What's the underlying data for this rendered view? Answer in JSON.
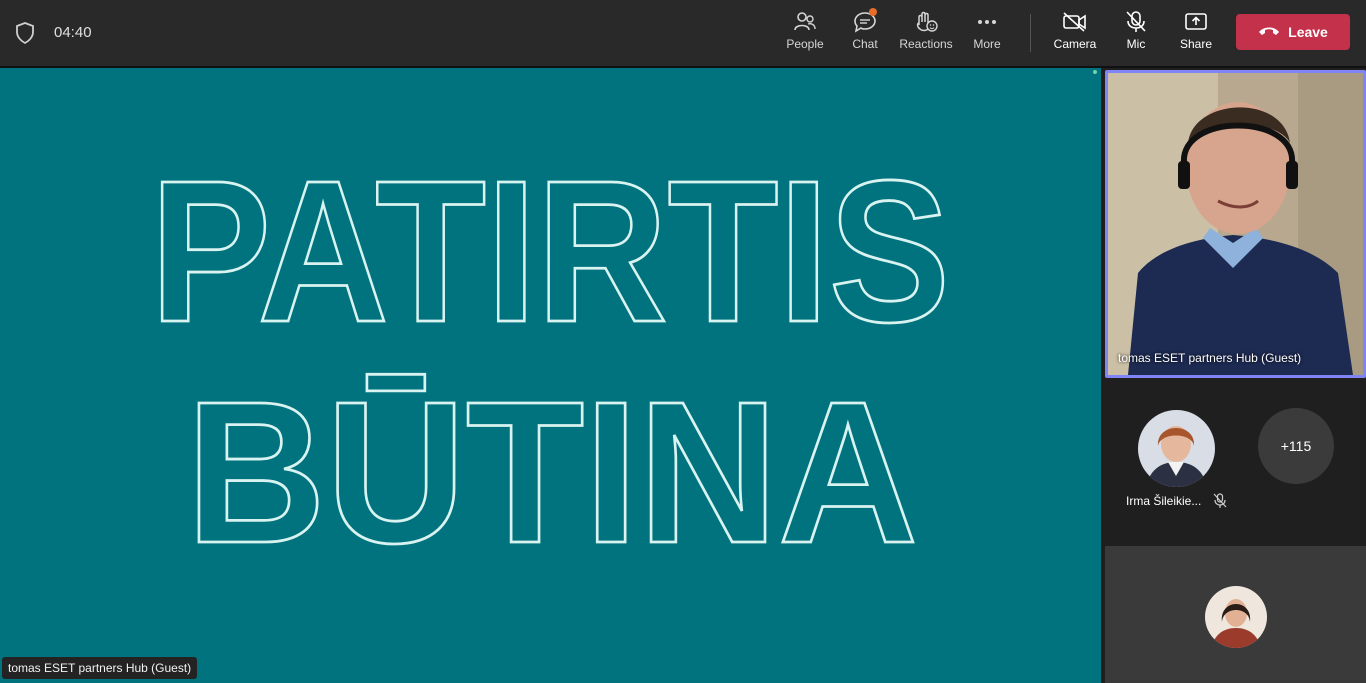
{
  "topbar": {
    "timer": "04:40",
    "people_label": "People",
    "chat_label": "Chat",
    "reactions_label": "Reactions",
    "more_label": "More",
    "camera_label": "Camera",
    "mic_label": "Mic",
    "share_label": "Share",
    "leave_label": "Leave"
  },
  "stage": {
    "slide_line1": "PATIRTIS",
    "slide_line2": "BŪTINA",
    "presenter_tag": "tomas ESET partners Hub (Guest)",
    "background_color": "#00737f"
  },
  "panel": {
    "video_name": "tomas ESET partners Hub (Guest)",
    "participant_name": "Irma Šileikie...",
    "overflow_count": "+115"
  },
  "colors": {
    "leave": "#c4314b",
    "active_border": "#7f85f5",
    "notification": "#e66c2c"
  }
}
